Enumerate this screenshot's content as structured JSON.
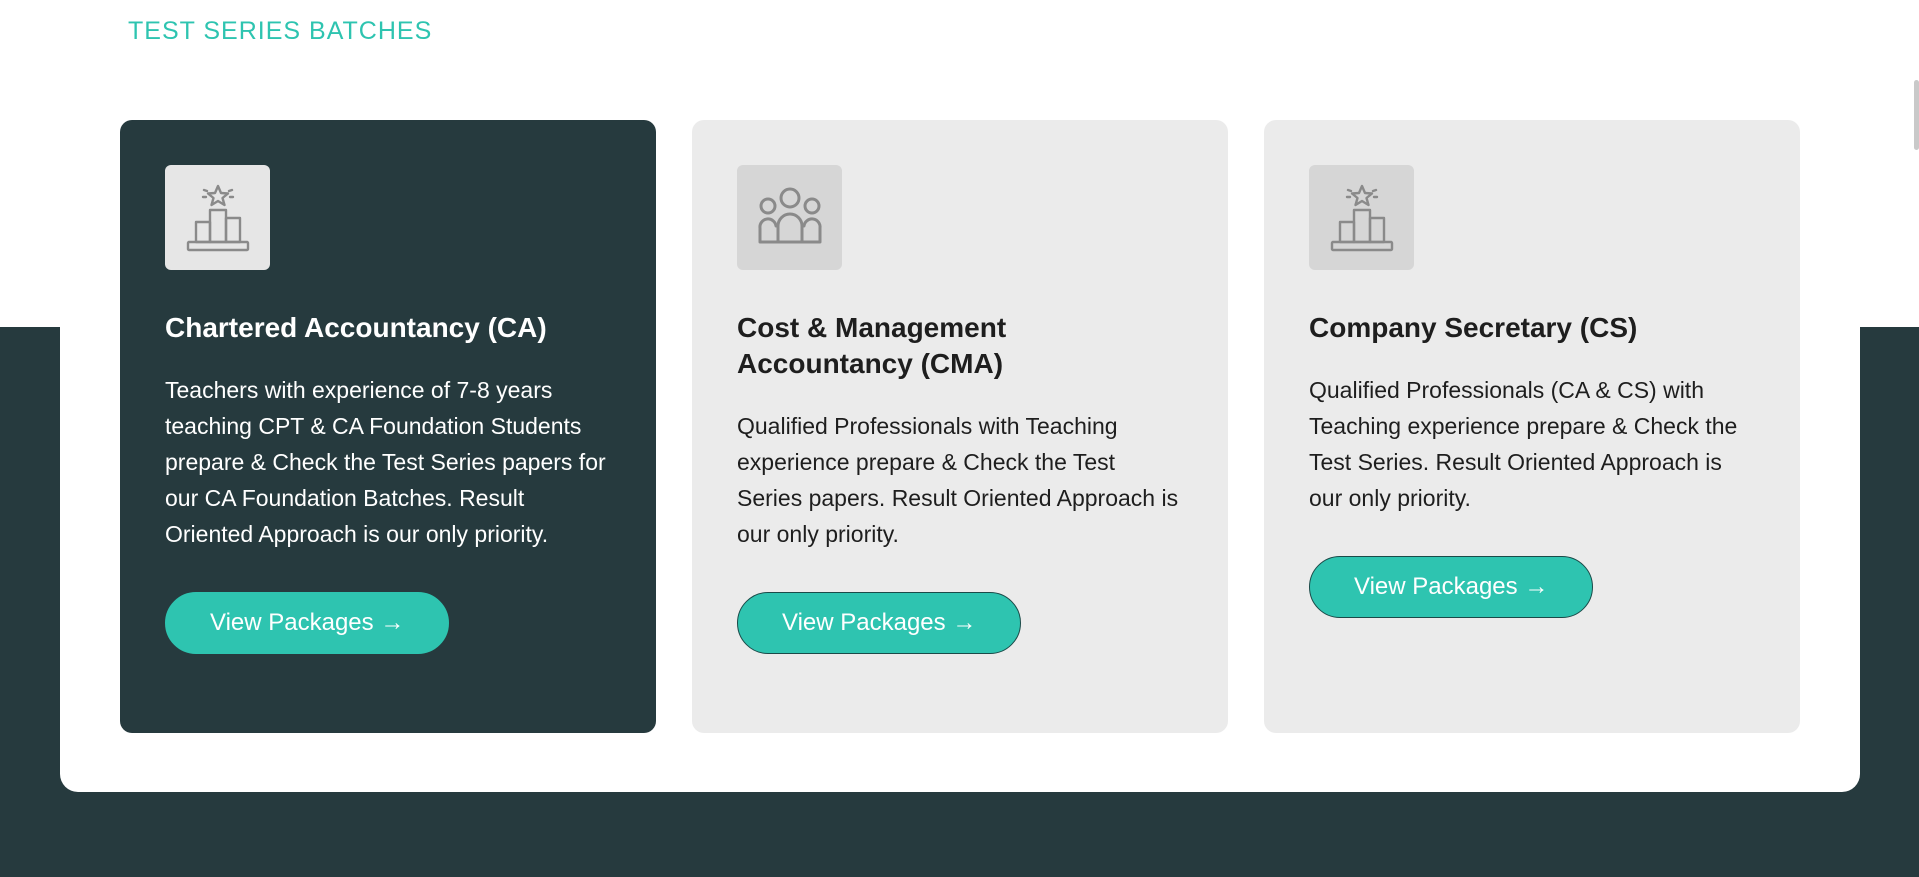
{
  "section": {
    "label": "TEST SERIES BATCHES"
  },
  "cards": [
    {
      "icon": "podium-star-icon",
      "title": "Chartered Accountancy (CA)",
      "description": "Teachers with experience of 7-8 years teaching CPT & CA Foundation Students prepare & Check the Test Series papers for our CA Foundation Batches. Result Oriented Approach is our only priority.",
      "button_label": "View Packages →"
    },
    {
      "icon": "users-group-icon",
      "title": "Cost & Management Accountancy (CMA)",
      "description": "Qualified Professionals with Teaching experience prepare & Check the Test Series papers. Result Oriented Approach is our only priority.",
      "button_label": "View Packages →"
    },
    {
      "icon": "podium-star-icon",
      "title": "Company Secretary (CS)",
      "description": "Qualified Professionals (CA & CS) with Teaching experience prepare & Check the Test Series. Result Oriented Approach is our only priority.",
      "button_label": "View Packages →"
    }
  ],
  "colors": {
    "accent": "#2ec4b0",
    "dark": "#263a3e",
    "card_light": "#ebebeb"
  }
}
